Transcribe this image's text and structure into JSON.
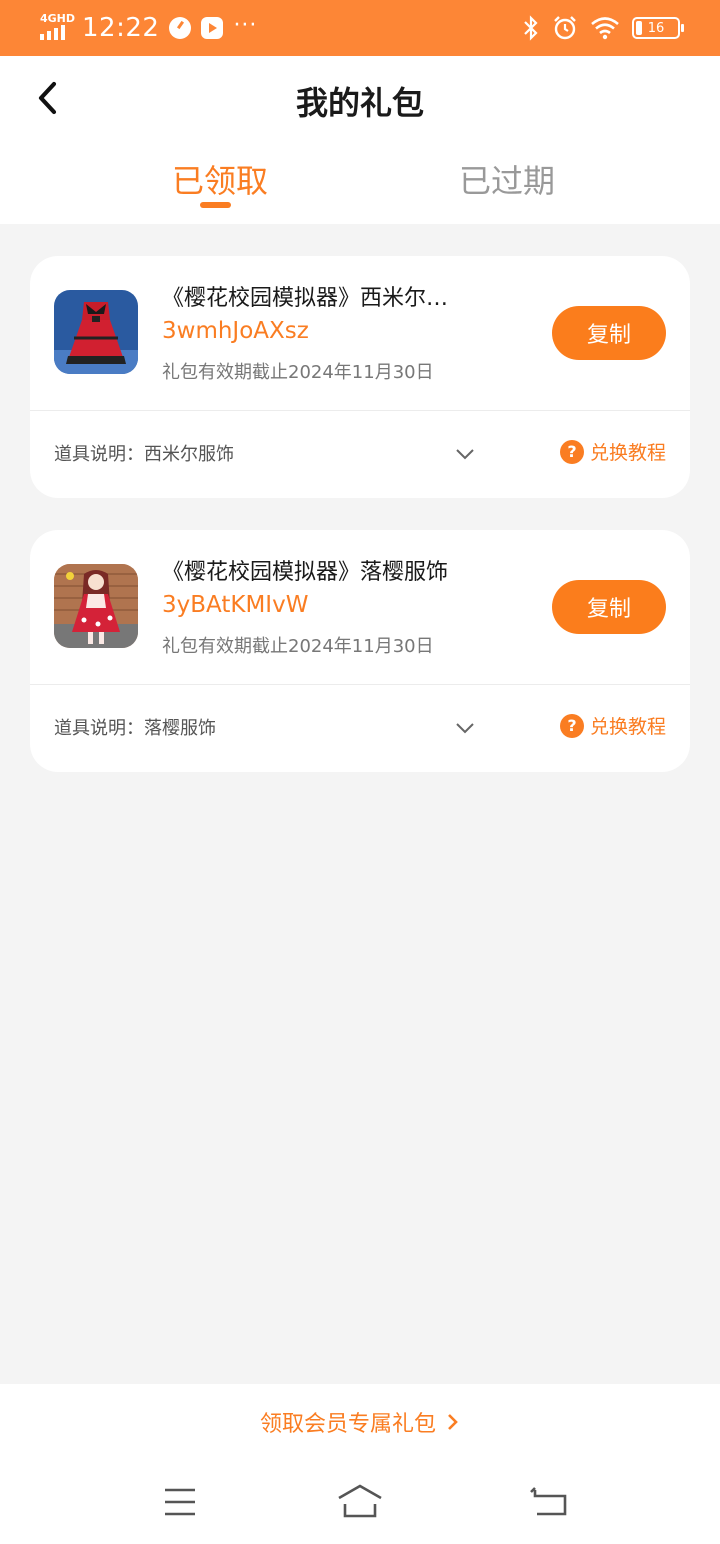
{
  "status_bar": {
    "network": "4GHD",
    "time": "12:22",
    "dots": "···",
    "battery": "16"
  },
  "header": {
    "title": "我的礼包",
    "tabs": [
      {
        "label": "已领取",
        "active": true
      },
      {
        "label": "已过期",
        "active": false
      }
    ]
  },
  "gifts": [
    {
      "name": "《樱花校园模拟器》西米尔…",
      "code": "3wmhJoAXsz",
      "expiry": "礼包有效期截止2024年11月30日",
      "copy_label": "复制",
      "description": "道具说明：西米尔服饰",
      "tutorial_label": "兑换教程"
    },
    {
      "name": "《樱花校园模拟器》落樱服饰",
      "code": "3yBAtKMIvW",
      "expiry": "礼包有效期截止2024年11月30日",
      "copy_label": "复制",
      "description": "道具说明：落樱服饰",
      "tutorial_label": "兑换教程"
    }
  ],
  "footer": {
    "member_link": "领取会员专属礼包"
  },
  "colors": {
    "accent": "#fa7d22",
    "status_bar": "#fd8636"
  }
}
